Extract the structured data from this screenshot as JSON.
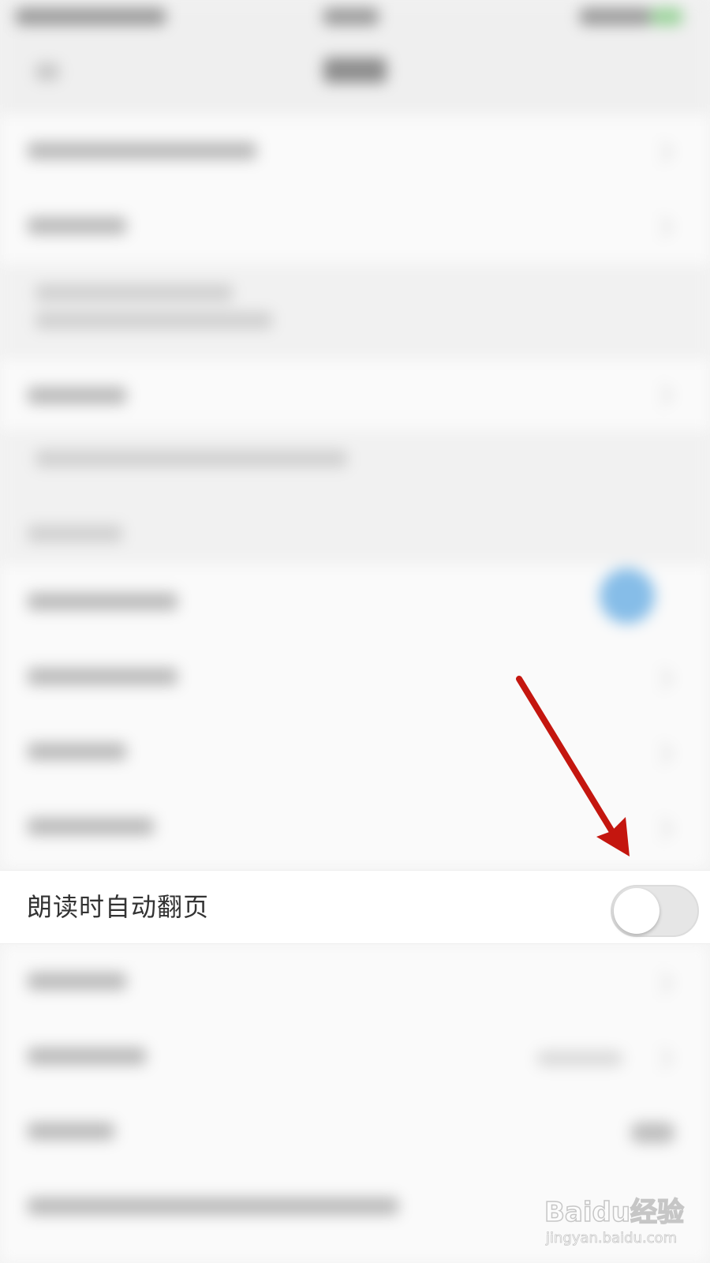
{
  "settings": {
    "highlighted_row": {
      "label": "朗读时自动翻页",
      "toggle_state": "off"
    }
  },
  "watermark": {
    "logo_text": "Baidu经验",
    "url_text": "jingyan.baidu.com"
  },
  "colors": {
    "arrow": "#c4160f",
    "toggle_track_off": "#e6e6e6",
    "toggle_knob": "#ffffff",
    "blurred_toggle_on": "#86bde8"
  }
}
